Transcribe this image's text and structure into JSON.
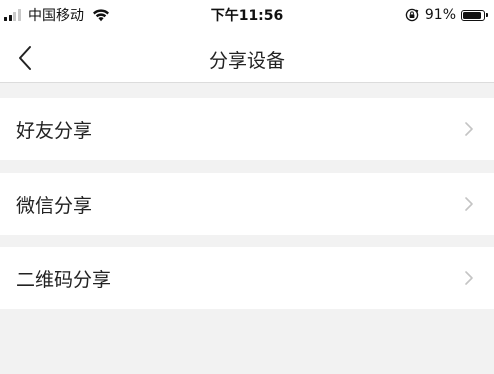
{
  "status_bar": {
    "carrier": "中国移动",
    "time": "下午11:56",
    "battery_text": "91%",
    "battery_level": 0.91,
    "signal_bars_active": 2,
    "signal_bars_total": 4,
    "icons": [
      "signal-icon",
      "wifi-icon",
      "rotation-lock-icon",
      "battery-icon"
    ]
  },
  "nav": {
    "title": "分享设备",
    "back_icon": "chevron-left-icon"
  },
  "list": {
    "items": [
      {
        "label": "好友分享",
        "icon": "chevron-right-icon"
      },
      {
        "label": "微信分享",
        "icon": "chevron-right-icon"
      },
      {
        "label": "二维码分享",
        "icon": "chevron-right-icon"
      }
    ]
  },
  "colors": {
    "background": "#f2f2f2",
    "surface": "#ffffff",
    "text": "#222222",
    "chevron": "#c4c4c4",
    "divider": "#dcdcdc"
  }
}
